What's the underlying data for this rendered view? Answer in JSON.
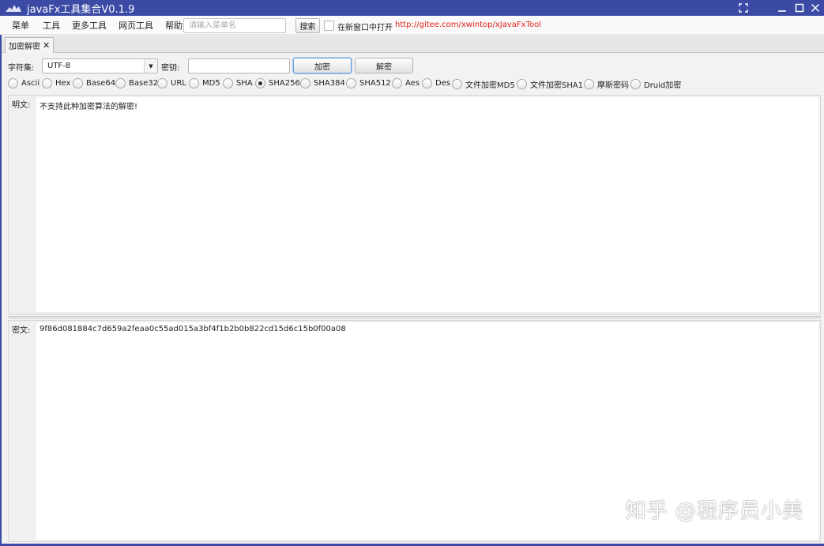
{
  "window": {
    "title": "javaFx工具集合V0.1.9",
    "accent": "#3a4aa5"
  },
  "menu": {
    "items": [
      "菜单",
      "工具",
      "更多工具",
      "网页工具",
      "帮助"
    ],
    "search_placeholder": "请输入菜单名",
    "search_button": "搜索",
    "new_window_label": "在新窗口中打开",
    "link": "http://gitee.com/xwintop/xJavaFxTool",
    "link_color": "#e0201a"
  },
  "tab": {
    "label": "加密解密"
  },
  "toolbar": {
    "charset_label": "字符集:",
    "charset_value": "UTF-8",
    "key_label": "密钥:",
    "key_value": "",
    "encrypt_button": "加密",
    "decrypt_button": "解密"
  },
  "algorithms": {
    "options": [
      "Ascii",
      "Hex",
      "Base64",
      "Base32",
      "URL",
      "MD5",
      "SHA",
      "SHA256",
      "SHA384",
      "SHA512",
      "Aes",
      "Des",
      "文件加密MD5",
      "文件加密SHA1",
      "摩斯密码",
      "Druid加密"
    ],
    "selected": "SHA256"
  },
  "plaintext": {
    "label": "明文:",
    "value": "不支持此种加密算法的解密!"
  },
  "ciphertext": {
    "label": "密文:",
    "value": "9f86d081884c7d659a2feaa0c55ad015a3bf4f1b2b0b822cd15d6c15b0f00a08"
  },
  "watermark": "知乎 @程序员小美"
}
